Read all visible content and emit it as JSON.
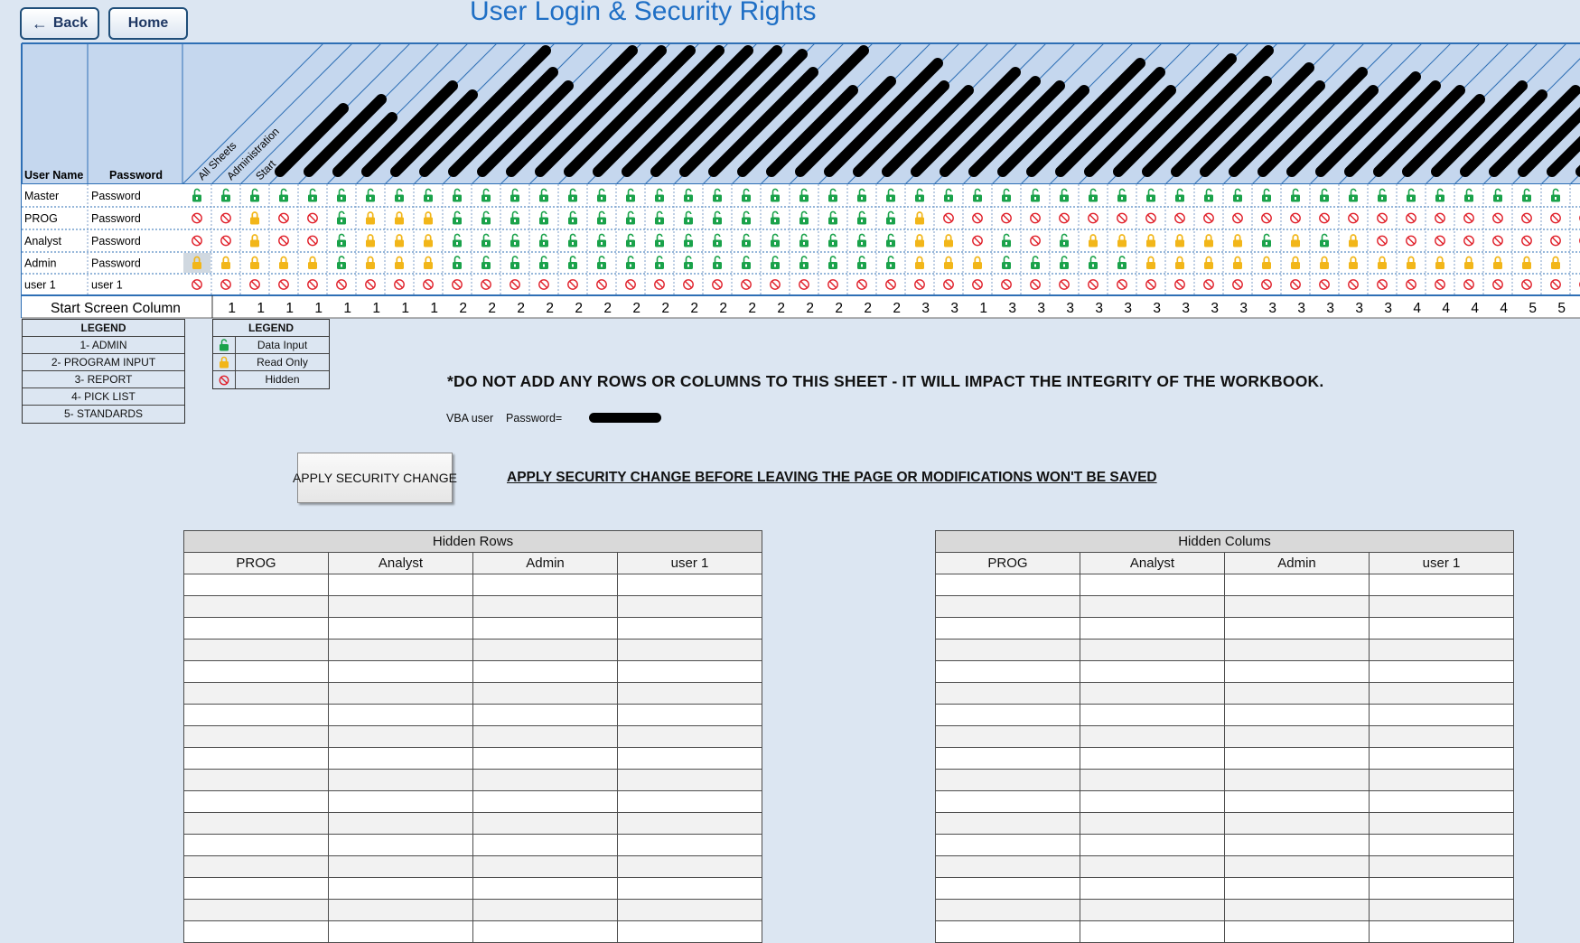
{
  "nav": {
    "back_label": "Back",
    "home_label": "Home"
  },
  "page_title": "User Login & Security Rights",
  "matrix": {
    "user_header": "User Name",
    "password_header": "Password",
    "column_headers": [
      "All Sheets",
      "Administration",
      "Start"
    ],
    "users": [
      {
        "name": "Master",
        "password": "Password",
        "rights": "DDDDDDDDDDDDDDDDDDDDDDDDDDDDDDDDDDDDDDDDDDDDDDDDDD"
      },
      {
        "name": "PROG",
        "password": "Password",
        "rights": "HHRHHDRRRDDDDDDDDDDDDDDDDRHHHHHHHHHHHHHHHHHHHHHHHH"
      },
      {
        "name": "Analyst",
        "password": "Password",
        "rights": "HHRHHDRRRDDDDDDDDDDDDDDDDRRHDHDRRRRRRDRDRHHHHHHHHH"
      },
      {
        "name": "Admin",
        "password": "Password",
        "rights": "RRRRRDRRRDDDDDDDDDDDDDDDDRRRDDDDDRRRRRRRRRRRRRRRRR"
      },
      {
        "name": "user 1",
        "password": "user 1",
        "rights": "HHHHHHHHHHHHHHHHHHHHHHHHHHHHHHHHHHHHHHHHHHHHHHHHHH"
      }
    ],
    "start_screen_label": "Start Screen Column",
    "start_screen_values": [
      1,
      1,
      1,
      1,
      1,
      1,
      1,
      1,
      2,
      2,
      2,
      2,
      2,
      2,
      2,
      2,
      2,
      2,
      2,
      2,
      2,
      2,
      2,
      2,
      3,
      3,
      1,
      3,
      3,
      3,
      3,
      3,
      3,
      3,
      3,
      3,
      3,
      3,
      3,
      3,
      3,
      4,
      4,
      4,
      4,
      5,
      5
    ]
  },
  "legend_categories": {
    "title": "LEGEND",
    "items": [
      "1- ADMIN",
      "2- PROGRAM INPUT",
      "3- REPORT",
      "4- PICK LIST",
      "5- STANDARDS"
    ]
  },
  "legend_icons": {
    "title": "LEGEND",
    "items": [
      {
        "icon": "unlocked-padlock-icon",
        "label": "Data Input"
      },
      {
        "icon": "locked-padlock-icon",
        "label": "Read Only"
      },
      {
        "icon": "no-entry-icon",
        "label": "Hidden"
      }
    ]
  },
  "warning_text": "*DO NOT ADD ANY ROWS OR COLUMNS TO THIS SHEET - IT WILL IMPACT THE INTEGRITY OF THE WORKBOOK.",
  "vba": {
    "user_label": "VBA user",
    "password_label": "Password="
  },
  "apply_button_label": "APPLY SECURITY CHANGE",
  "apply_note": "APPLY SECURITY CHANGE BEFORE LEAVING THE PAGE OR MODIFICATIONS WON'T BE SAVED",
  "hidden_rows": {
    "title": "Hidden Rows",
    "columns": [
      "PROG",
      "Analyst",
      "Admin",
      "user 1"
    ]
  },
  "hidden_columns": {
    "title": "Hidden Colums",
    "columns": [
      "PROG",
      "Analyst",
      "Admin",
      "user 1"
    ]
  },
  "colors": {
    "data_input": "#1aa24a",
    "read_only": "#f2b619",
    "hidden": "#e0202a",
    "title_blue": "#1f6fc5",
    "grid_blue": "#2e6fb5"
  }
}
